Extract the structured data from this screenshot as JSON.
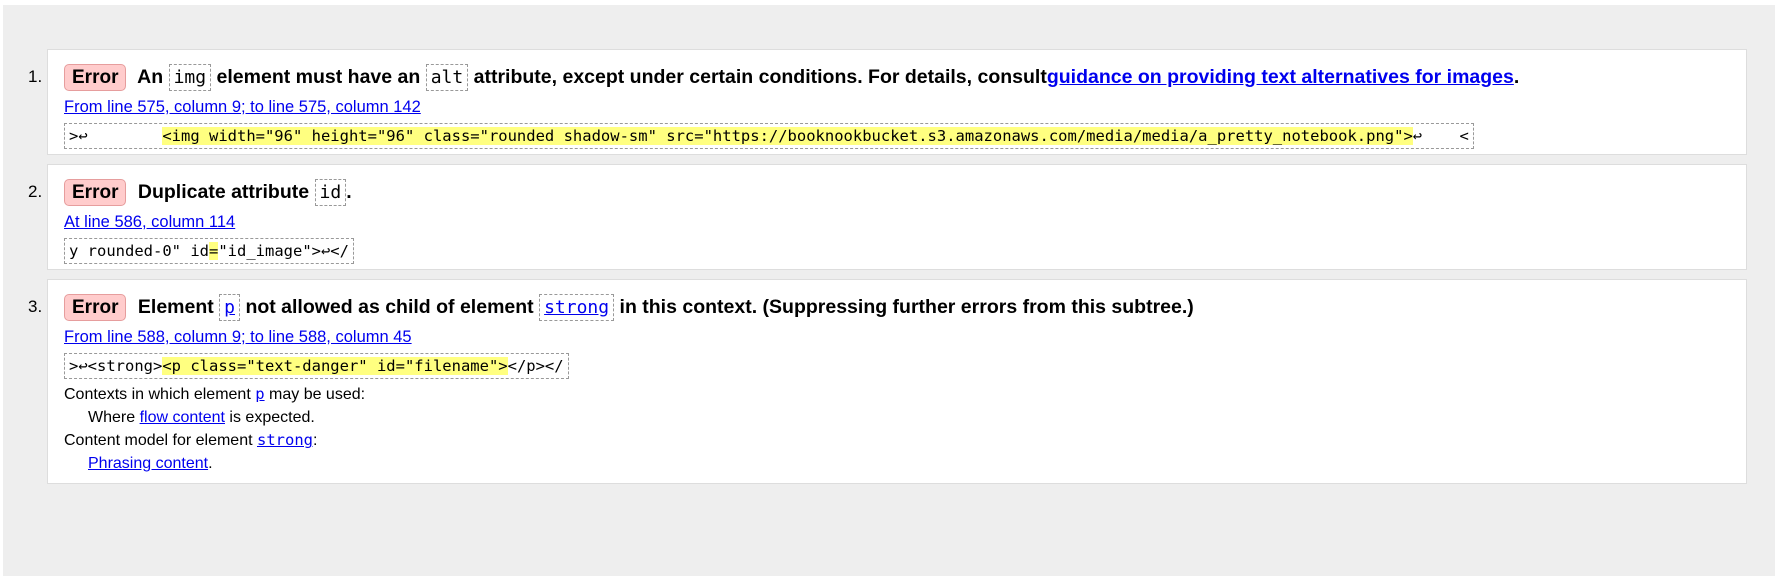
{
  "messages": [
    {
      "number": "1.",
      "badge": "Error",
      "text": {
        "before": "An",
        "code1": "img",
        "middle": "element must have an",
        "code2": "alt",
        "after": "attribute, except under certain conditions. For details, consult",
        "link": "guidance on providing text alternatives for images",
        "end": "."
      },
      "location": "From line 575, column 9; to line 575, column 142",
      "extract": {
        "pre": ">↩        ",
        "highlight": "<img width=\"96\" height=\"96\" class=\"rounded shadow-sm\" src=\"https://booknookbucket.s3.amazonaws.com/media/media/a_pretty_notebook.png\">",
        "post": "↩    <"
      }
    },
    {
      "number": "2.",
      "badge": "Error",
      "text": {
        "before": "Duplicate attribute",
        "code1": "id",
        "end": "."
      },
      "location": "At line 586, column 114",
      "extract": {
        "pre": "y rounded-0\" id",
        "highlight": "=",
        "post": "\"id_image\">↩</"
      }
    },
    {
      "number": "3.",
      "badge": "Error",
      "text": {
        "before": "Element",
        "code1": "p",
        "middle": "not allowed as child of element",
        "code2": "strong",
        "after": "in this context. (Suppressing further errors from this subtree.)"
      },
      "location": "From line 588, column 9; to line 588, column 45",
      "extract": {
        "pre": ">↩<strong>",
        "highlight": "<p class=\"text-danger\" id=\"filename\">",
        "post": "</p></"
      },
      "notes": {
        "contexts_prefix": "Contexts in which element",
        "contexts_code": "p",
        "contexts_suffix": "may be used:",
        "where_prefix": "Where",
        "where_link": "flow content",
        "where_suffix": "is expected.",
        "model_prefix": "Content model for element",
        "model_code": "strong",
        "model_suffix": ":",
        "phrasing_link": "Phrasing content",
        "phrasing_suffix": "."
      }
    }
  ]
}
